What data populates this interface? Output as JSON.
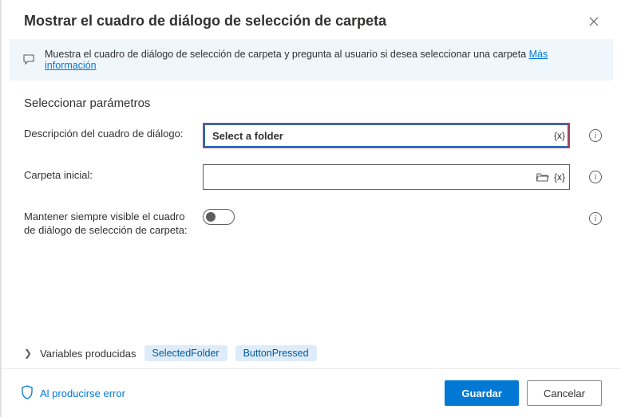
{
  "header": {
    "title": "Mostrar el cuadro de diálogo de selección de carpeta"
  },
  "banner": {
    "text": "Muestra el cuadro de diálogo de selección de carpeta y pregunta al usuario si desea seleccionar una carpeta ",
    "link": "Más información"
  },
  "section_title": "Seleccionar parámetros",
  "params": {
    "description": {
      "label": "Descripción del cuadro de diálogo:",
      "value": "Select a folder"
    },
    "initial_folder": {
      "label": "Carpeta inicial:",
      "value": ""
    },
    "keep_visible": {
      "label": "Mantener siempre visible el cuadro de diálogo de selección de carpeta:"
    }
  },
  "variables": {
    "label": "Variables producidas",
    "chips": [
      "SelectedFolder",
      "ButtonPressed"
    ]
  },
  "footer": {
    "error": "Al producirse error",
    "save": "Guardar",
    "cancel": "Cancelar"
  },
  "var_token": "{x}"
}
